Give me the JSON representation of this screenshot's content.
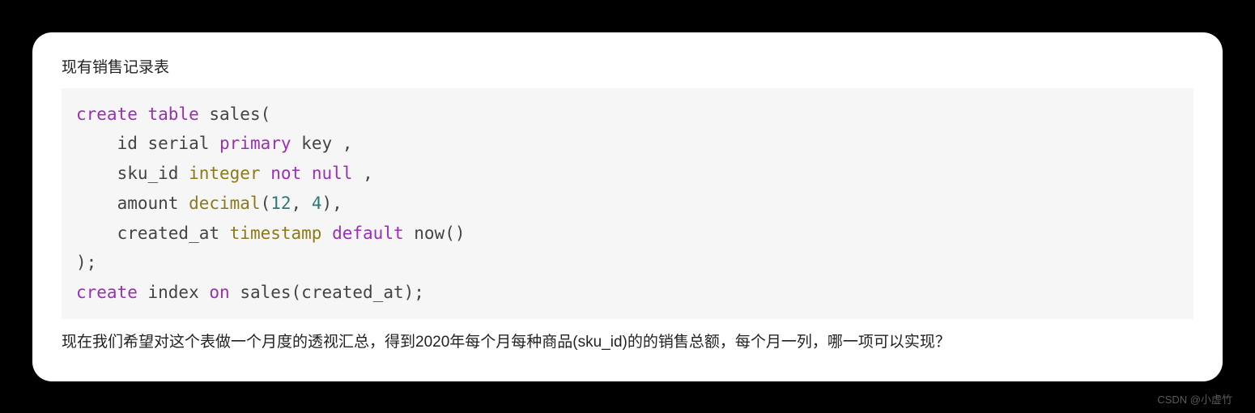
{
  "card": {
    "intro": "现有销售记录表",
    "outro": "现在我们希望对这个表做一个月度的透视汇总，得到2020年每个月每种商品(sku_id)的的销售总额，每个月一列，哪一项可以实现？"
  },
  "code": {
    "l1": {
      "t1": "create",
      "t2": "table",
      "t3": " sales("
    },
    "l2": {
      "t1": "    id serial ",
      "t2": "primary",
      "t3": " key ,"
    },
    "l3": {
      "t1": "    sku_id ",
      "t2": "integer",
      "t3": "not",
      "t4": "null",
      "t5": " ,"
    },
    "l4": {
      "t1": "    amount ",
      "t2": "decimal",
      "t3": "(",
      "t4": "12",
      "t5": ", ",
      "t6": "4",
      "t7": "),"
    },
    "l5": {
      "t1": "    created_at ",
      "t2": "timestamp",
      "t3": "default",
      "t4": " now()"
    },
    "l6": {
      "t1": ");"
    },
    "l7": {
      "t1": "create",
      "t2": " index ",
      "t3": "on",
      "t4": " sales(created_at);"
    }
  },
  "watermark": "CSDN @小虚竹"
}
